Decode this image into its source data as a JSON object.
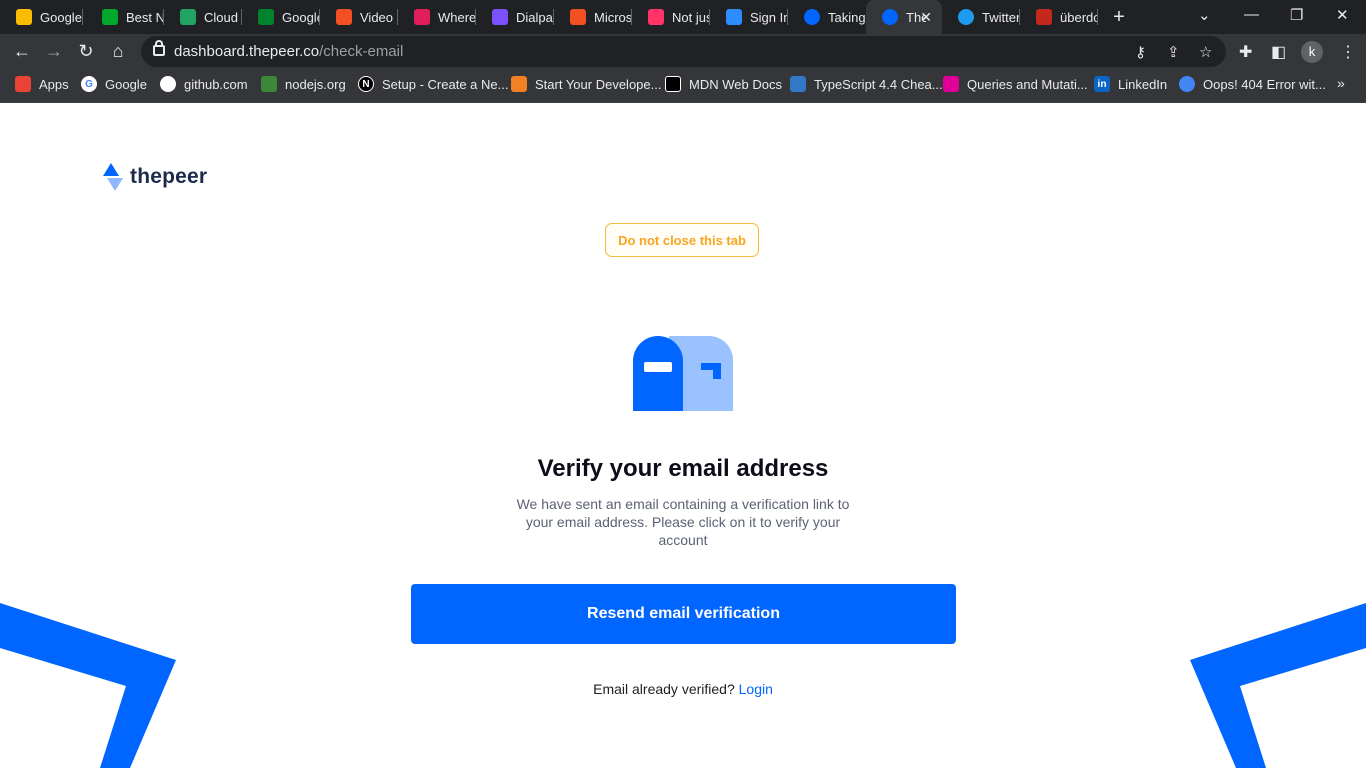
{
  "tabs": [
    {
      "title": "Google",
      "favicon": "google-keep-icon",
      "color": "#fbbc04"
    },
    {
      "title": "Best N",
      "favicon": "evernote-icon",
      "color": "#00a82d"
    },
    {
      "title": "Cloud S",
      "favicon": "google-drive-icon",
      "color": "#1fa463"
    },
    {
      "title": "Google",
      "favicon": "google-meet-icon",
      "color": "#00832d"
    },
    {
      "title": "Video C",
      "favicon": "microsoft-icon",
      "color": "#f25022"
    },
    {
      "title": "Where",
      "favicon": "slack-icon",
      "color": "#e01e5a"
    },
    {
      "title": "Dialpad",
      "favicon": "dialpad-icon",
      "color": "#7c52ff"
    },
    {
      "title": "Micros",
      "favicon": "microsoft-icon",
      "color": "#f25022"
    },
    {
      "title": "Not jus",
      "favicon": "invision-icon",
      "color": "#ff3366"
    },
    {
      "title": "Sign In",
      "favicon": "zoom-icon",
      "color": "#2d8cff"
    },
    {
      "title": "Taking",
      "favicon": "thepeer-icon",
      "color": "#0066ff"
    },
    {
      "title": "The",
      "favicon": "thepeer-icon",
      "color": "#0066ff"
    },
    {
      "title": "Twitter",
      "favicon": "twitter-icon",
      "color": "#1d9bf0"
    },
    {
      "title": "überdo",
      "favicon": "uberdoc-icon",
      "color": "#c4281c"
    }
  ],
  "address_bar": {
    "domain": "dashboard.thepeer.co",
    "path": "/check-email"
  },
  "profile_initial": "k",
  "bookmarks": [
    {
      "label": "Apps",
      "icon": "apps-grid-icon",
      "color": "#ea4335"
    },
    {
      "label": "Google",
      "icon": "google-icon",
      "color": "#4285f4"
    },
    {
      "label": "github.com",
      "icon": "github-icon",
      "color": "#ffffff"
    },
    {
      "label": "nodejs.org",
      "icon": "nodejs-icon",
      "color": "#3c873a"
    },
    {
      "label": "Setup - Create a Ne...",
      "icon": "nextjs-icon",
      "color": "#000000"
    },
    {
      "label": "Start Your Develope...",
      "icon": "stackoverflow-icon",
      "color": "#f48024"
    },
    {
      "label": "MDN Web Docs",
      "icon": "mdn-icon",
      "color": "#000000"
    },
    {
      "label": "TypeScript 4.4 Chea...",
      "icon": "typescript-icon",
      "color": "#3178c6"
    },
    {
      "label": "Queries and Mutati...",
      "icon": "graphql-icon",
      "color": "#e10098"
    },
    {
      "label": "LinkedIn",
      "icon": "linkedin-icon",
      "color": "#0a66c2"
    },
    {
      "label": "Oops! 404 Error wit...",
      "icon": "globe-icon",
      "color": "#4285f4"
    }
  ],
  "page": {
    "logo_text": "thepeer",
    "warning": "Do not close this tab",
    "heading": "Verify your email address",
    "description": "We have sent an email containing a verification link to your email address. Please click on it to verify your account",
    "resend_button": "Resend email verification",
    "already_verified": "Email already verified?",
    "login_link": "Login"
  },
  "colors": {
    "brand": "#0066ff",
    "brand_light": "#99c2ff",
    "warning": "#f5a623",
    "heading": "#0d0d1a"
  }
}
